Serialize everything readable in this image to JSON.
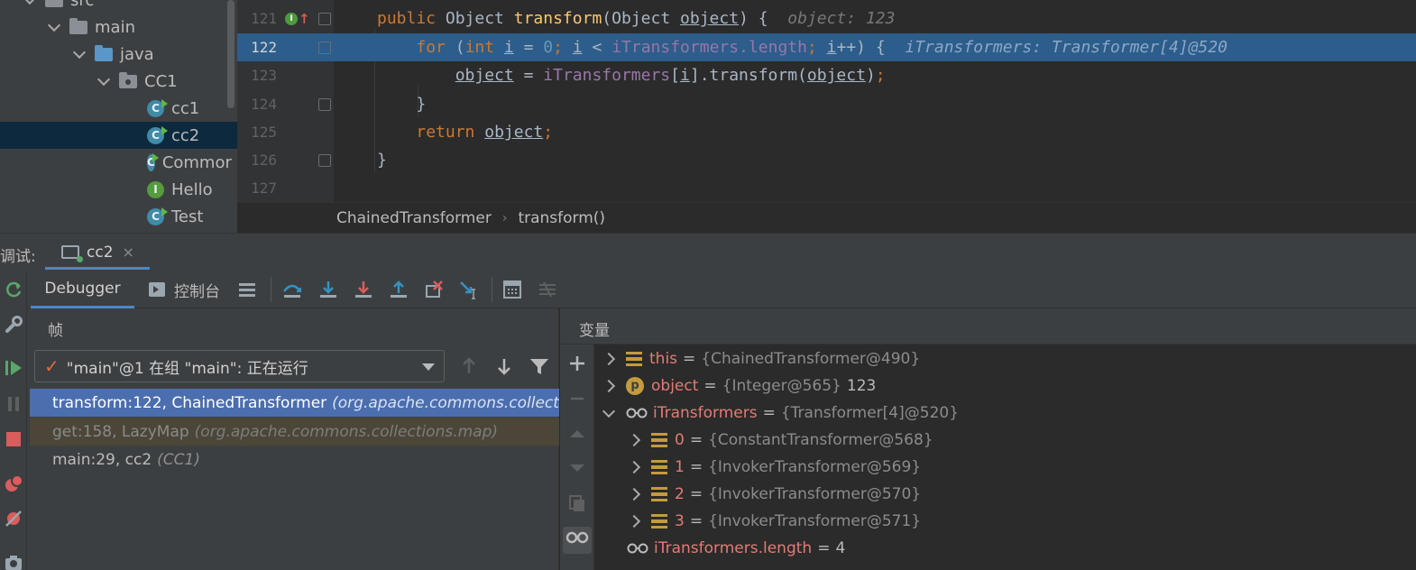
{
  "project_tree": {
    "items": [
      {
        "label": "src",
        "kind": "folder"
      },
      {
        "label": "main",
        "kind": "folder"
      },
      {
        "label": "java",
        "kind": "source-folder"
      },
      {
        "label": "CC1",
        "kind": "package"
      },
      {
        "label": "cc1",
        "kind": "class",
        "icon_letter": "C"
      },
      {
        "label": "cc2",
        "kind": "class",
        "icon_letter": "C",
        "selected": true
      },
      {
        "label": "Commor",
        "kind": "class",
        "icon_letter": "C"
      },
      {
        "label": "Hello",
        "kind": "interface",
        "icon_letter": "I"
      },
      {
        "label": "Test",
        "kind": "class",
        "icon_letter": "C"
      }
    ]
  },
  "editor": {
    "lines": [
      {
        "number": "121"
      },
      {
        "number": "122"
      },
      {
        "number": "123"
      },
      {
        "number": "124"
      },
      {
        "number": "125"
      },
      {
        "number": "126"
      },
      {
        "number": "127"
      }
    ],
    "gutter_icon_letter": "I",
    "gutter_arrow": "↑",
    "tokens": {
      "public": "public",
      "Object": "Object",
      "transform": "transform",
      "lparen": "(",
      "object": "object",
      "rparen_brace": ") {",
      "for": "for",
      "int": "int",
      "i": "i",
      "eq": "=",
      "zero": "0",
      "semi": ";",
      "lt": "<",
      "iTransformers": "iTransformers",
      "length": ".length",
      "incr": "++",
      "call_dot": ".transform(",
      "open_idx": "[",
      "close_idx": "]",
      "close_call": ")",
      "close_brace": "}",
      "return": "return"
    },
    "hints": {
      "line121": "object: 123",
      "line122": "iTransformers: Transformer[4]@520"
    },
    "breadcrumb": [
      "ChainedTransformer",
      "transform()"
    ],
    "breadcrumb_sep": "›"
  },
  "debug": {
    "title": "调试:",
    "tab_label": "cc2",
    "tab_close": "×",
    "toolbar": {
      "debugger_label": "Debugger",
      "console_label": "控制台"
    },
    "frames": {
      "title": "帧",
      "thread_selector": "\"main\"@1 在组 \"main\": 正在运行",
      "check_glyph": "✓",
      "items": [
        {
          "method": "transform:122, ChainedTransformer",
          "package": "(org.apache.commons.collect"
        },
        {
          "method": "get:158, LazyMap",
          "package": "(org.apache.commons.collections.map)"
        },
        {
          "method": "main:29, cc2",
          "package": "(CC1)"
        }
      ]
    },
    "variables": {
      "title": "变量",
      "items": [
        {
          "name": "this",
          "eq": "=",
          "value": "{ChainedTransformer@490}",
          "tail": ""
        },
        {
          "name": "object",
          "eq": "=",
          "value": "{Integer@565}",
          "tail": "123",
          "icon_letter": "p"
        },
        {
          "name": "iTransformers",
          "eq": "=",
          "value": "{Transformer[4]@520}",
          "tail": ""
        },
        {
          "name": "0",
          "eq": "=",
          "value": "{ConstantTransformer@568}",
          "tail": ""
        },
        {
          "name": "1",
          "eq": "=",
          "value": "{InvokerTransformer@569}",
          "tail": ""
        },
        {
          "name": "2",
          "eq": "=",
          "value": "{InvokerTransformer@570}",
          "tail": ""
        },
        {
          "name": "3",
          "eq": "=",
          "value": "{InvokerTransformer@571}",
          "tail": ""
        },
        {
          "name": "iTransformers.length",
          "eq": "=",
          "value": "",
          "tail": "4"
        }
      ]
    }
  },
  "colors": {
    "exec_line": "#2d5d8a",
    "active_frame": "#4b6eaf",
    "keyword": "#cc7832",
    "method": "#ffc66d",
    "field": "#9876aa",
    "number": "#6897bb",
    "var_name": "#e57b74"
  }
}
